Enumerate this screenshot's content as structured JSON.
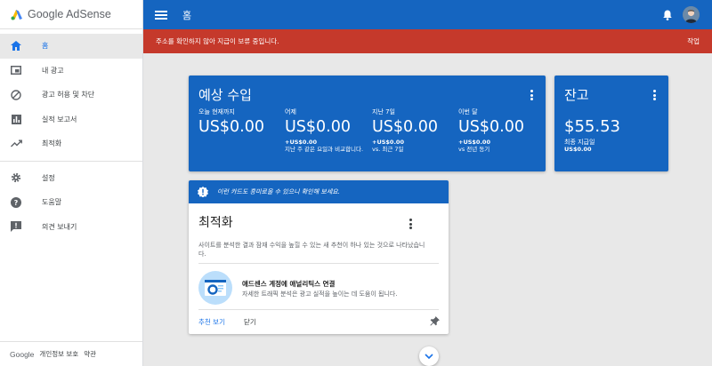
{
  "app": {
    "logo_text": "Google AdSense",
    "brand_blue": "#1565c0",
    "alert_red": "#c5392b"
  },
  "sidebar": {
    "items": [
      {
        "label": "홈",
        "icon": "home-icon",
        "active": true
      },
      {
        "label": "내 광고",
        "icon": "ads-icon"
      },
      {
        "label": "광고 허용 및 차단",
        "icon": "block-icon"
      },
      {
        "label": "실적 보고서",
        "icon": "bar-chart-icon"
      },
      {
        "label": "최적화",
        "icon": "trending-up-icon"
      },
      {
        "label": "설정",
        "icon": "gear-icon"
      },
      {
        "label": "도움말",
        "icon": "help-icon"
      },
      {
        "label": "의견 보내기",
        "icon": "feedback-icon"
      }
    ],
    "footer": {
      "google": "Google",
      "privacy": "개인정보 보호",
      "terms": "약관"
    }
  },
  "topbar": {
    "title": "홈"
  },
  "alert": {
    "message": "주소를 확인하지 않아 지급이 보류 중입니다.",
    "action": "작업"
  },
  "earnings": {
    "title": "예상 수입",
    "columns": [
      {
        "label": "오늘 현재까지",
        "value": "US$0.00",
        "sub": "",
        "compare": ""
      },
      {
        "label": "어제",
        "value": "US$0.00",
        "sub": "+US$0.00",
        "compare": "지난 주 같은 요일과 비교합니다."
      },
      {
        "label": "지난 7일",
        "value": "US$0.00",
        "sub": "+US$0.00",
        "compare": "vs. 최근 7일"
      },
      {
        "label": "이번 달",
        "value": "US$0.00",
        "sub": "+US$0.00",
        "compare": "vs 전년 동기"
      }
    ]
  },
  "balance": {
    "title": "잔고",
    "value": "$55.53",
    "label": "최종 지급일",
    "sub": "US$0.00"
  },
  "optimization": {
    "banner": "이런 카드도 흥미로울 수 있으니 확인해 보세요.",
    "title": "최적화",
    "description": "사이트를 분석한 결과 잠재 수익을 높힐 수 있는 새 추천이 하나 있는 것으로 나타났습니다.",
    "rec_title": "애드센스 계정에 애널리틱스 연결",
    "rec_desc": "자세한 트래픽 분석은 광고 실적을 높이는 데 도움이 됩니다.",
    "primary_action": "추천 보기",
    "dismiss_action": "닫기"
  }
}
